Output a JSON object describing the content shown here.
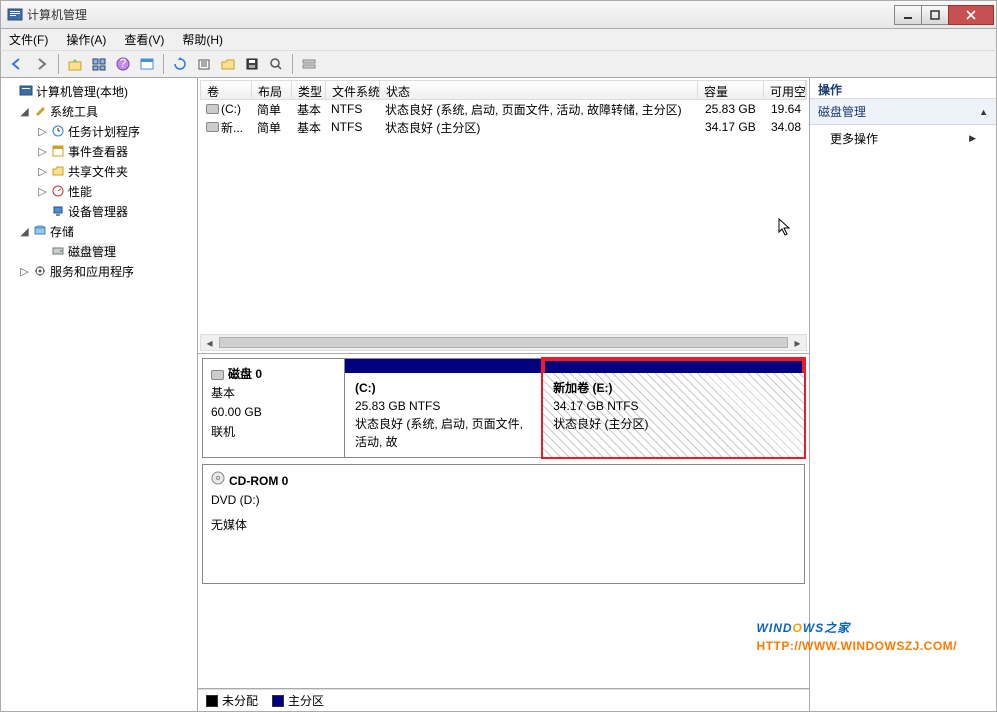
{
  "window": {
    "title": "计算机管理"
  },
  "menus": {
    "file": "文件(F)",
    "operation": "操作(A)",
    "view": "查看(V)",
    "help": "帮助(H)"
  },
  "tree": {
    "root": "计算机管理(本地)",
    "systools": "系统工具",
    "scheduler": "任务计划程序",
    "eventviewer": "事件查看器",
    "shared": "共享文件夹",
    "perf": "性能",
    "device": "设备管理器",
    "storage": "存储",
    "diskmgmt": "磁盘管理",
    "services": "服务和应用程序"
  },
  "columns": {
    "vol": "卷",
    "layout": "布局",
    "type": "类型",
    "fs": "文件系统",
    "status": "状态",
    "cap": "容量",
    "free": "可用空"
  },
  "volumes": [
    {
      "name": "(C:)",
      "layout": "简单",
      "type": "基本",
      "fs": "NTFS",
      "status": "状态良好 (系统, 启动, 页面文件, 活动, 故障转储, 主分区)",
      "cap": "25.83 GB",
      "free": "19.64"
    },
    {
      "name": "新...",
      "layout": "简单",
      "type": "基本",
      "fs": "NTFS",
      "status": "状态良好 (主分区)",
      "cap": "34.17 GB",
      "free": "34.08"
    }
  ],
  "disks": {
    "disk0": {
      "title": "磁盘 0",
      "kind": "基本",
      "size": "60.00 GB",
      "state": "联机"
    },
    "cdrom": {
      "title": "CD-ROM 0",
      "kind": "DVD (D:)",
      "media": "无媒体"
    },
    "partC": {
      "name": "(C:)",
      "size": "25.83 GB NTFS",
      "status": "状态良好 (系统, 启动, 页面文件, 活动, 故"
    },
    "partE": {
      "name": "新加卷   (E:)",
      "size": "34.17 GB NTFS",
      "status": "状态良好 (主分区)"
    }
  },
  "legend": {
    "unalloc": "未分配",
    "primary": "主分区"
  },
  "actions": {
    "header": "操作",
    "section": "磁盘管理",
    "more": "更多操作"
  },
  "watermark": {
    "brand_pre": "WIND",
    "brand_o": "O",
    "brand_post": "WS",
    "brand_zh": "之家",
    "url": "HTTP://WWW.WINDOWSZJ.COM/"
  }
}
